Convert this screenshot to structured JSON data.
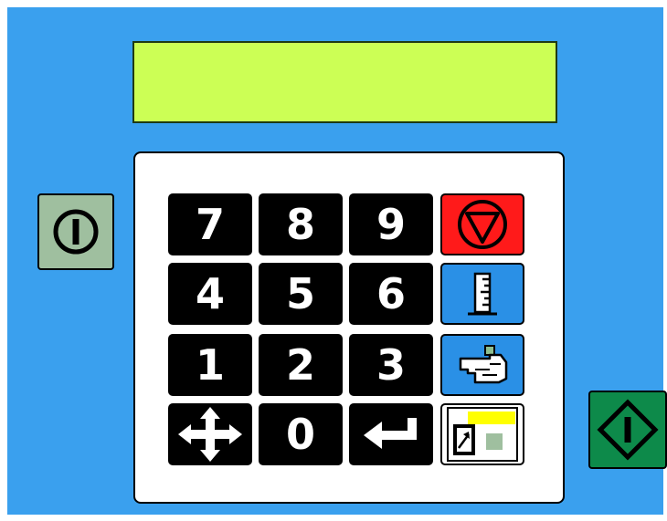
{
  "display": {
    "text": ""
  },
  "keypad": {
    "keys": {
      "k7": "7",
      "k8": "8",
      "k9": "9",
      "k4": "4",
      "k5": "5",
      "k6": "6",
      "k1": "1",
      "k2": "2",
      "k3": "3",
      "k0": "0"
    },
    "function_keys": [
      {
        "id": "stop",
        "icon": "stop-triangle-icon",
        "color": "#ff1a1a"
      },
      {
        "id": "gauge",
        "icon": "ruler-gauge-icon",
        "color": "#2a90e6"
      },
      {
        "id": "hand",
        "icon": "hand-pointer-icon",
        "color": "#2a90e6"
      },
      {
        "id": "menu",
        "icon": "window-menu-icon",
        "color": "#ffffff"
      },
      {
        "id": "move",
        "icon": "four-way-arrow-icon"
      },
      {
        "id": "enter",
        "icon": "enter-arrow-icon"
      }
    ]
  },
  "side_buttons": {
    "power": {
      "icon": "power-icon",
      "color": "#9fbf9f"
    },
    "start": {
      "icon": "start-diamond-icon",
      "color": "#0d8a4a"
    }
  },
  "colors": {
    "background": "#3aa0ee",
    "display": "#ccff55",
    "key": "#000000",
    "panel": "#ffffff"
  }
}
